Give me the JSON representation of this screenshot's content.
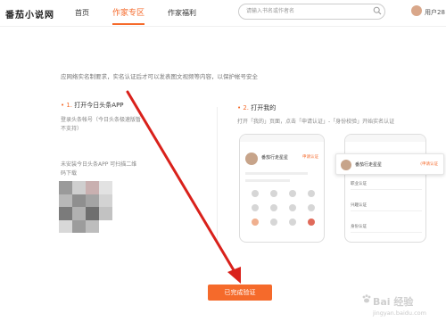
{
  "header": {
    "logo": "番茄小说网",
    "nav": [
      "首页",
      "作家专区",
      "作家福利"
    ],
    "active_index": 1,
    "search_placeholder": "请输入书名或作者名",
    "user_name": "用户28"
  },
  "main": {
    "notice": "应网络实名制要求，实名认证后才可以发表图文视频等内容，以保护帐号安全",
    "step1": {
      "num": "• 1.",
      "title": "打开今日头条APP",
      "desc": "登录头条帐号（今日头条极速版暂不支持）",
      "no_app": "未安装今日头条APP 可扫描二维码下载"
    },
    "step2": {
      "num": "• 2.",
      "title": "打开我的",
      "desc": "打开「我的」页面，点击「申请认证」-「身份校验」开始实名认证"
    },
    "phone": {
      "user": "番茄行走星星",
      "tag": "申请认证"
    },
    "card": {
      "user": "番茄行走星星",
      "tag": "(申请认证"
    },
    "phone2_items": [
      "职业认证",
      "兴趣认证",
      "身份认证"
    ],
    "done_button": "已完成验证"
  },
  "watermark": {
    "line1": "Bai 经验",
    "line2": "jingyan.baidu.com"
  },
  "colors": {
    "accent": "#f56a2b",
    "arrow": "#d9211b"
  }
}
